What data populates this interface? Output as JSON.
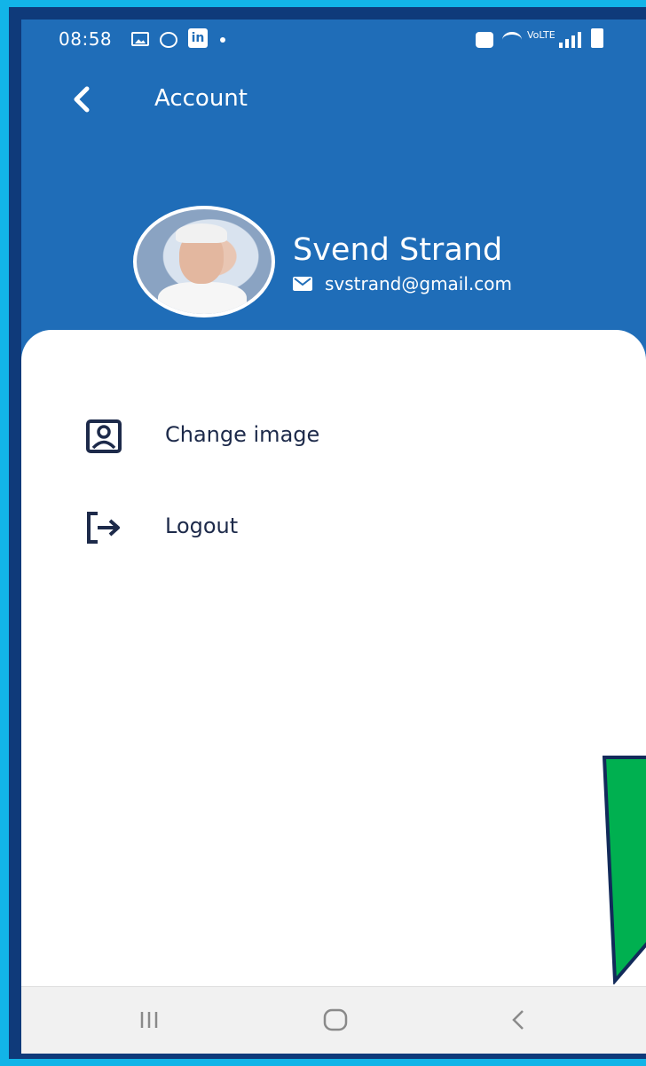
{
  "statusbar": {
    "time": "08:58",
    "left_icons": [
      "gallery-icon",
      "messenger-icon",
      "linkedin-icon",
      "notification-dot-icon"
    ],
    "right_icons": [
      "camera-icon",
      "wifi-icon",
      "volte-icon",
      "signal-icon",
      "battery-icon"
    ],
    "linkedin_text": "in",
    "volte_text": "VoLTE"
  },
  "header": {
    "title": "Account",
    "background_color": "#1f6db8"
  },
  "profile": {
    "name": "Svend Strand",
    "email": "svstrand@gmail.com"
  },
  "menu": {
    "items": [
      {
        "label": "Change image",
        "icon": "portrait-icon"
      },
      {
        "label": "Logout",
        "icon": "logout-icon"
      }
    ]
  },
  "navbar": {
    "buttons": [
      "recents-button",
      "home-button",
      "back-button"
    ]
  },
  "colors": {
    "accent": "#1f6db8",
    "frame": "#0f3a7a",
    "outer": "#12b4e8",
    "annotation_arrow": "#00b050"
  }
}
